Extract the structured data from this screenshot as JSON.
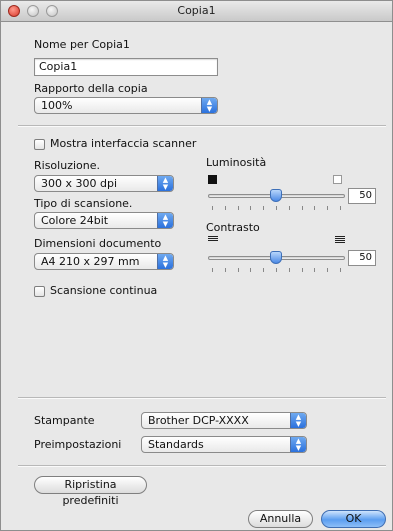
{
  "window": {
    "title": "Copia1"
  },
  "name_section": {
    "name_label": "Nome per Copia1",
    "name_value": "Copia1",
    "ratio_label": "Rapporto della copia",
    "ratio_value": "100%"
  },
  "scanner": {
    "show_interface_label": "Mostra interfaccia scanner",
    "show_interface_checked": false,
    "resolution_label": "Risoluzione.",
    "resolution_value": "300 x 300 dpi",
    "scan_type_label": "Tipo di scansione.",
    "scan_type_value": "Colore 24bit",
    "doc_size_label": "Dimensioni documento",
    "doc_size_value": "A4 210 x 297 mm",
    "continuous_label": "Scansione continua",
    "continuous_checked": false
  },
  "brightness": {
    "label": "Luminosità",
    "value": "50"
  },
  "contrast": {
    "label": "Contrasto",
    "value": "50"
  },
  "bottom": {
    "printer_label": "Stampante",
    "printer_value": "Brother DCP-XXXX",
    "presets_label": "Preimpostazioni",
    "presets_value": "Standards",
    "restore_button": "Ripristina predefiniti",
    "cancel_button": "Annulla",
    "ok_button": "OK"
  }
}
